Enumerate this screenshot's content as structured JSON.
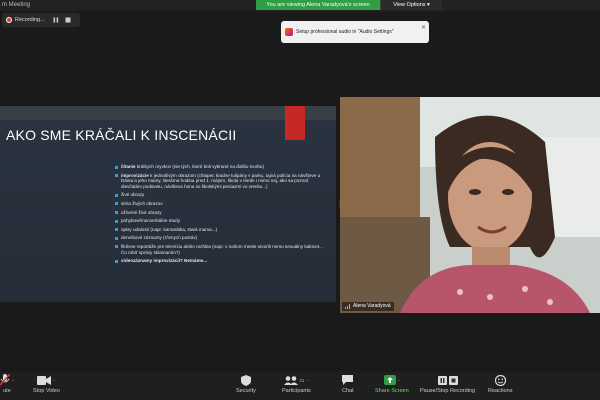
{
  "window": {
    "title": "m Meeting"
  },
  "banner": {
    "share_text": "You are viewing Alena Varadyová's screen",
    "view_options": "View Options ▾"
  },
  "recording": {
    "label": "Recording...",
    "pause_icon": "pause-icon",
    "stop_icon": "stop-icon"
  },
  "toast": {
    "text": "Setup professional audio in ",
    "link": "\"Audio Settings\""
  },
  "slide": {
    "title": "AKO SME KRÁČALI K INSCENÁCII",
    "bullets": [
      {
        "bold": "čítanie",
        "text": " krátkych úryvkov (nie tých, ktoré boli vybrané na ďalšiu tvorbu)"
      },
      {
        "bold": "improvizácie",
        "text": " k jednotlivým obrazom (chlapec kradne tulipány v parku, tajná polícia na návšteve u Dávta a jeho mamy, literárna hodina pred 1. májom, škola v triede i mimo nej, ako sa poznať dievčatám podsvetu, návšteva hona so školskými peniazmi vo vrecku...)"
      },
      {
        "bold": "",
        "text": "živé obrazy"
      },
      {
        "bold": "",
        "text": "séria živých obrazov"
      },
      {
        "bold": "",
        "text": "ožívené živé obrazy"
      },
      {
        "bold": "",
        "text": "pohybové/nonverbálne etudy"
      },
      {
        "bold": "",
        "text": "opisy udalostí (napr. kamarátka, stará mama...)"
      },
      {
        "bold": "",
        "text": "denníkové záznamy (rôznych postáv)"
      },
      {
        "bold": "",
        "text": "fiktívne reportáže pre televíziu alebo rozhlas (napr. v našom meste otvorili nemu sexuálny kabinet... Čo robiť správy sklamaním?)"
      },
      {
        "bold": "videozáznamy improvizácií? Nemáme...",
        "text": ""
      }
    ]
  },
  "video": {
    "participant_name": "Alena Varadyová"
  },
  "toolbar": {
    "buttons": [
      {
        "label": "ute",
        "icon": "microphone-muted-icon"
      },
      {
        "label": "Stop Video",
        "icon": "video-camera-icon"
      },
      {
        "label": "Security",
        "icon": "shield-icon"
      },
      {
        "label": "Participants",
        "icon": "participants-icon",
        "count": "21"
      },
      {
        "label": "Chat",
        "icon": "chat-icon"
      },
      {
        "label": "Share Screen",
        "icon": "share-screen-icon"
      },
      {
        "label": "Pause/Stop Recording",
        "icon": "pause-stop-recording-icon"
      },
      {
        "label": "Reactions",
        "icon": "reactions-icon"
      }
    ]
  },
  "colors": {
    "share_green": "#2f9e44",
    "slide_bg": "#2a3340",
    "slide_accent": "#c62828",
    "bullet": "#3a9bd9",
    "record_red": "#e53935"
  }
}
